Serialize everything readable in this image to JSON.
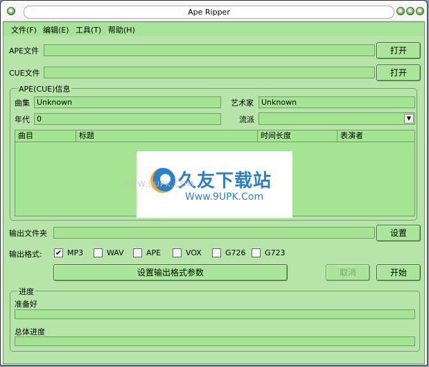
{
  "window": {
    "title": "Ape Ripper"
  },
  "menu": [
    "文件(F)",
    "编辑(E)",
    "工具(T)",
    "帮助(H)"
  ],
  "ape_file": {
    "label": "APE文件",
    "value": "",
    "button": "打开"
  },
  "cue_file": {
    "label": "CUE文件",
    "value": "",
    "button": "打开"
  },
  "info": {
    "title": "APE(CUE)信息",
    "album_label": "曲集",
    "album_value": "Unknown",
    "artist_label": "艺术家",
    "artist_value": "Unknown",
    "year_label": "年代",
    "year_value": "0",
    "genre_label": "流派",
    "genre_value": "",
    "columns": [
      "曲目",
      "标题",
      "时间长度",
      "表演者"
    ]
  },
  "output": {
    "folder_label": "输出文件夹",
    "folder_value": "",
    "set_button": "设置",
    "format_label": "输出格式:",
    "formats": [
      {
        "name": "MP3",
        "checked": true
      },
      {
        "name": "WAV",
        "checked": false
      },
      {
        "name": "APE",
        "checked": false
      },
      {
        "name": "VOX",
        "checked": false
      },
      {
        "name": "G726",
        "checked": false
      },
      {
        "name": "G723",
        "checked": false
      }
    ],
    "params_button": "设置输出格式参数",
    "cancel_button": "取消",
    "start_button": "开始"
  },
  "progress": {
    "title": "进度",
    "status": "准备好",
    "current_value": 0,
    "total_label": "总体进度",
    "total_value": 0
  },
  "watermark": {
    "big": "久友下载站",
    "small": "Www.9UPK.Com",
    "url": "WWW.9UPK.COM"
  }
}
